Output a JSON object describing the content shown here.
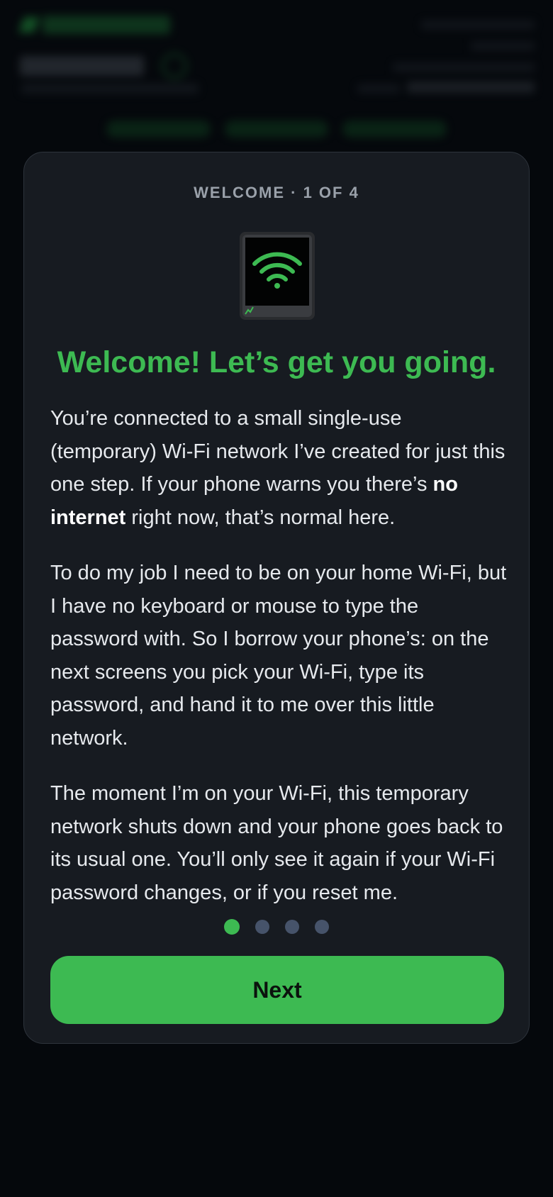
{
  "modal": {
    "step_label": "WELCOME · 1 OF 4",
    "headline": "Welcome! Let’s get you going.",
    "para1_part1": "You’re connected to a small single-use (temporary) Wi-Fi network I’ve created for just this one step. If your phone warns you there’s ",
    "para1_bold": "no internet",
    "para1_part2": " right now, that’s normal here.",
    "para2": "To do my job I need to be on your home Wi-Fi, but I have no keyboard or mouse to type the password with. So I borrow your phone’s: on the next screens you pick your Wi-Fi, type its password, and hand it to me over this little network.",
    "para3": "The moment I’m on your Wi-Fi, this temporary network shuts down and your phone goes back to its usual one. You’ll only see it again if your Wi-Fi password changes, or if you reset me.",
    "next_label": "Next",
    "pagination": {
      "total": 4,
      "current": 1
    }
  },
  "device_icon": "wifi-device-icon",
  "colors": {
    "accent": "#3dba52",
    "background": "#05080c",
    "card": "#171b21",
    "dot_inactive": "#46536a"
  }
}
